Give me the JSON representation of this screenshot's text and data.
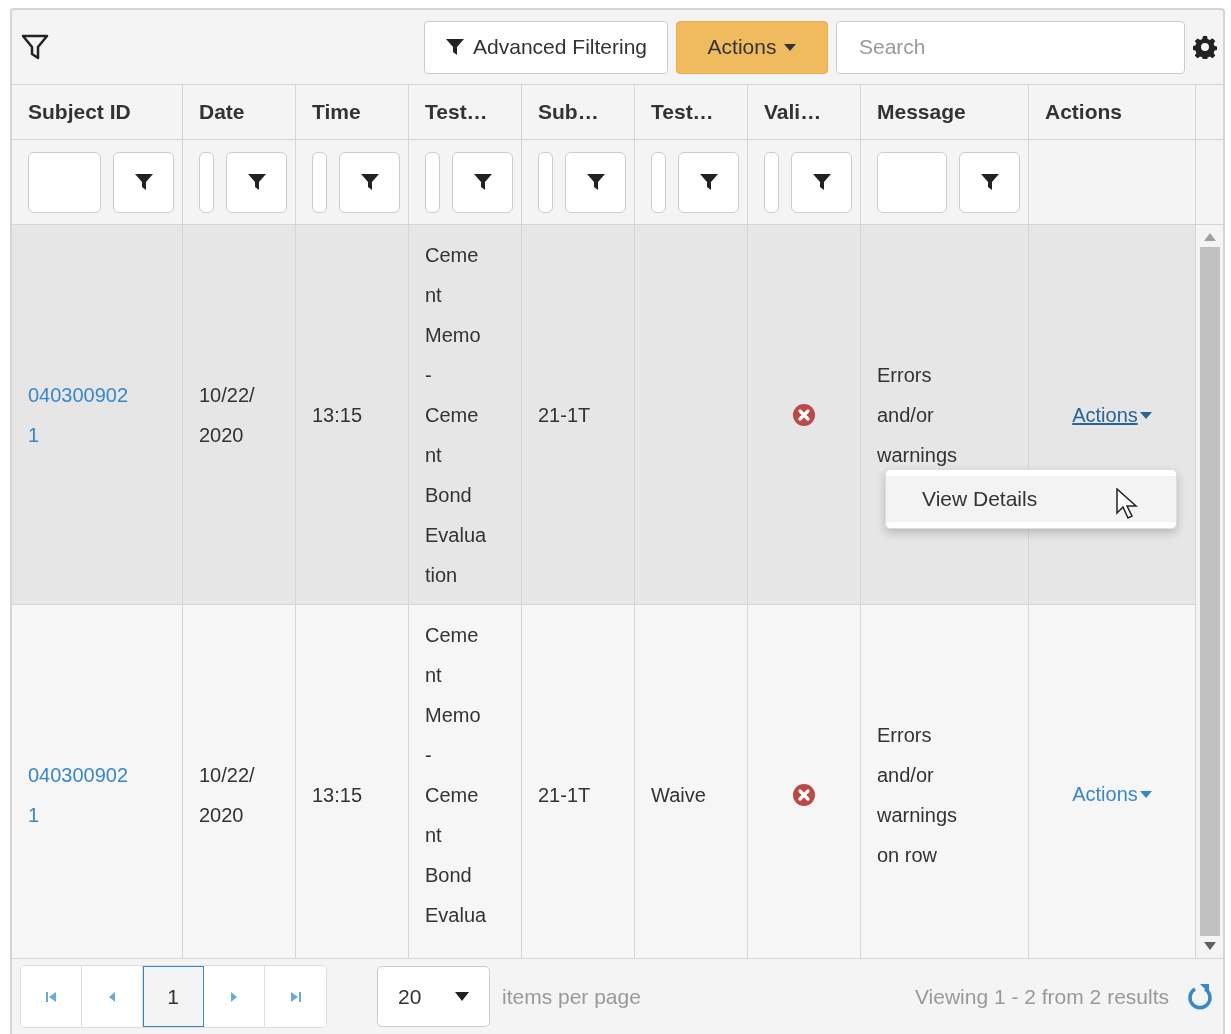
{
  "toolbar": {
    "advanced_filter_button": "Advanced Filtering",
    "actions_button": "Actions",
    "search": {
      "placeholder": "Search"
    }
  },
  "columns": [
    {
      "label": "Subject ID",
      "filter": true
    },
    {
      "label": "Date",
      "filter": true
    },
    {
      "label": "Time",
      "filter": true
    },
    {
      "label": "Test…",
      "filter": true
    },
    {
      "label": "Sub…",
      "filter": true
    },
    {
      "label": "Test…",
      "filter": true
    },
    {
      "label": "Vali…",
      "filter": true
    },
    {
      "label": "Message",
      "filter": true
    },
    {
      "label": "Actions",
      "filter": false
    }
  ],
  "rows": [
    {
      "selected": true,
      "cells": [
        {
          "kind": "link",
          "text": "0403009021"
        },
        {
          "kind": "text",
          "text": "10/22/2020"
        },
        {
          "kind": "text",
          "text": "13:15"
        },
        {
          "kind": "text",
          "text": "Cement Memo - Cement Bond Evaluation"
        },
        {
          "kind": "text",
          "text": "21-1T"
        },
        {
          "kind": "empty"
        },
        {
          "kind": "error"
        },
        {
          "kind": "text",
          "text": "Errors and/or warnings"
        },
        {
          "kind": "menu",
          "label": "Actions",
          "open": true,
          "items": [
            {
              "label": "View Details",
              "selected": true
            }
          ]
        }
      ]
    },
    {
      "selected": false,
      "cells": [
        {
          "kind": "link",
          "text": "0403009021"
        },
        {
          "kind": "text",
          "text": "10/22/2020"
        },
        {
          "kind": "text",
          "text": "13:15"
        },
        {
          "kind": "text",
          "text": "Cement Memo - Cement Bond Evalua"
        },
        {
          "kind": "text",
          "text": "21-1T"
        },
        {
          "kind": "text",
          "text": "Waive"
        },
        {
          "kind": "error"
        },
        {
          "kind": "text",
          "text": "Errors and/or warnings on row"
        },
        {
          "kind": "menu",
          "label": "Actions",
          "open": false
        }
      ]
    }
  ],
  "pager": {
    "pages": [
      {
        "label": "1",
        "selected": true
      }
    ],
    "page_size": "20",
    "page_size_label": "items per page",
    "summary": "Viewing 1 - 2 from 2 results"
  }
}
